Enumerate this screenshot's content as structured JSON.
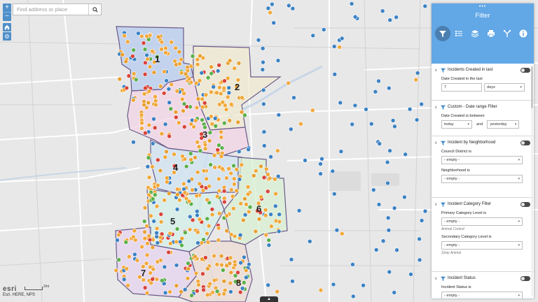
{
  "search": {
    "placeholder": "Find address or place"
  },
  "map": {
    "districts": [
      {
        "label": "1",
        "color": "#b8ccef"
      },
      {
        "label": "2",
        "color": "#f0ead0"
      },
      {
        "label": "3",
        "color": "#f3d4e6"
      },
      {
        "label": "4",
        "color": "#cfe3f1"
      },
      {
        "label": "5",
        "color": "#d4efea"
      },
      {
        "label": "6",
        "color": "#d9f0d3"
      },
      {
        "label": "7",
        "color": "#e7d4ef"
      },
      {
        "label": "8",
        "color": "#eedcd4"
      }
    ]
  },
  "attribution": {
    "logo": "esri",
    "text": "Esri, HERE, NPS",
    "scale": "2mi"
  },
  "panel": {
    "title": "Filter",
    "tools": [
      "filter-icon",
      "list-icon",
      "layers-icon",
      "print-icon",
      "directions-icon",
      "info-icon"
    ],
    "groups": [
      {
        "title": "Incidents Created in last",
        "label": "Date Created in the last",
        "value": "7",
        "unit": "days"
      },
      {
        "title": "Custom - Date range Filter",
        "label": "Date Created is between",
        "start": "today",
        "and": "and",
        "end": "yesterday"
      },
      {
        "title": "Incident by Neighborhood",
        "field1": "Council District is",
        "value1": "- empty -",
        "field2": "Neighborhood is",
        "value2": "- empty -"
      },
      {
        "title": "Incident Category Filter",
        "field1": "Primary Category Level is",
        "value1": "- empty -",
        "hint1": "Animal Control",
        "field2": "Secondary Category Level is",
        "value2": "- empty -",
        "hint2": "Stray Animal"
      },
      {
        "title": "Incident Status",
        "field1": "Incident Status is",
        "value1": "- empty -"
      }
    ]
  }
}
